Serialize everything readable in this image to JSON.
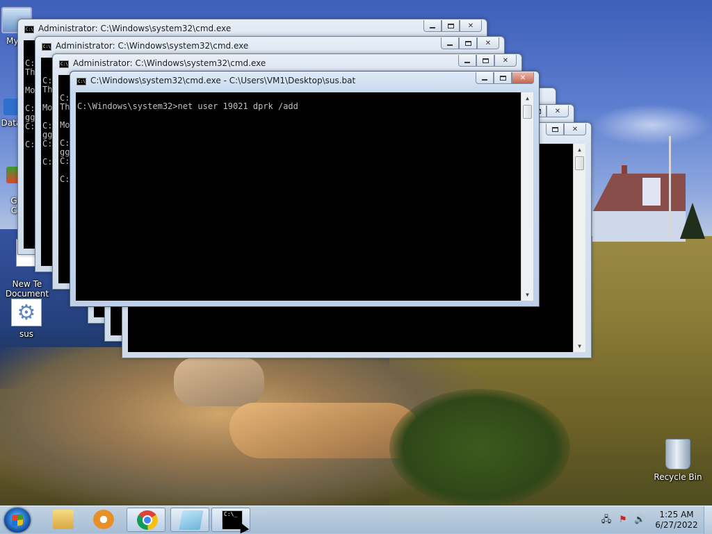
{
  "desktop": {
    "icons": [
      {
        "label": "My C",
        "icon": "computer-icon"
      },
      {
        "label": "Data",
        "icon": "app-icon"
      },
      {
        "label": "G\nC",
        "icon": "app-icon"
      },
      {
        "label": "New Te\nDocument",
        "icon": "document-icon"
      },
      {
        "label": "sus",
        "icon": "batch-file-gear-icon"
      },
      {
        "label": "Recycle Bin",
        "icon": "recycle-bin-icon"
      }
    ]
  },
  "windows": [
    {
      "title": "Administrator: C:\\Windows\\system32\\cmd.exe",
      "console_lines": [
        "",
        "C:",
        "Th",
        "",
        "Mo",
        "",
        "C:",
        "gg",
        "C:",
        "",
        "C:"
      ]
    },
    {
      "title": "Administrator: C:\\Windows\\system32\\cmd.exe",
      "console_lines": [
        "",
        "C:",
        "Th",
        "",
        "Mo",
        "",
        "C:",
        "gg",
        "C:",
        "",
        "C:"
      ]
    },
    {
      "title": "Administrator: C:\\Windows\\system32\\cmd.exe",
      "console_lines": [
        "",
        "C:",
        "Th",
        "",
        "Mo",
        "",
        "C:",
        "gg",
        "C:",
        "",
        "C:"
      ]
    },
    {
      "title": "C:\\Windows\\system32\\cmd.exe - C:\\Users\\VM1\\Desktop\\sus.bat",
      "console_lines": [
        "C:\\Windows\\system32>net user 19021 dprk /add"
      ]
    }
  ],
  "taskbar": {
    "pinned": [
      {
        "name": "windows-explorer",
        "icon": "folder-icon"
      },
      {
        "name": "media-player",
        "icon": "media-player-icon"
      },
      {
        "name": "chrome",
        "icon": "chrome-icon"
      },
      {
        "name": "notepad",
        "icon": "notepad-icon"
      },
      {
        "name": "command-prompt",
        "icon": "cmd-icon"
      }
    ],
    "clock": {
      "time": "1:25 AM",
      "date": "6/27/2022"
    }
  }
}
